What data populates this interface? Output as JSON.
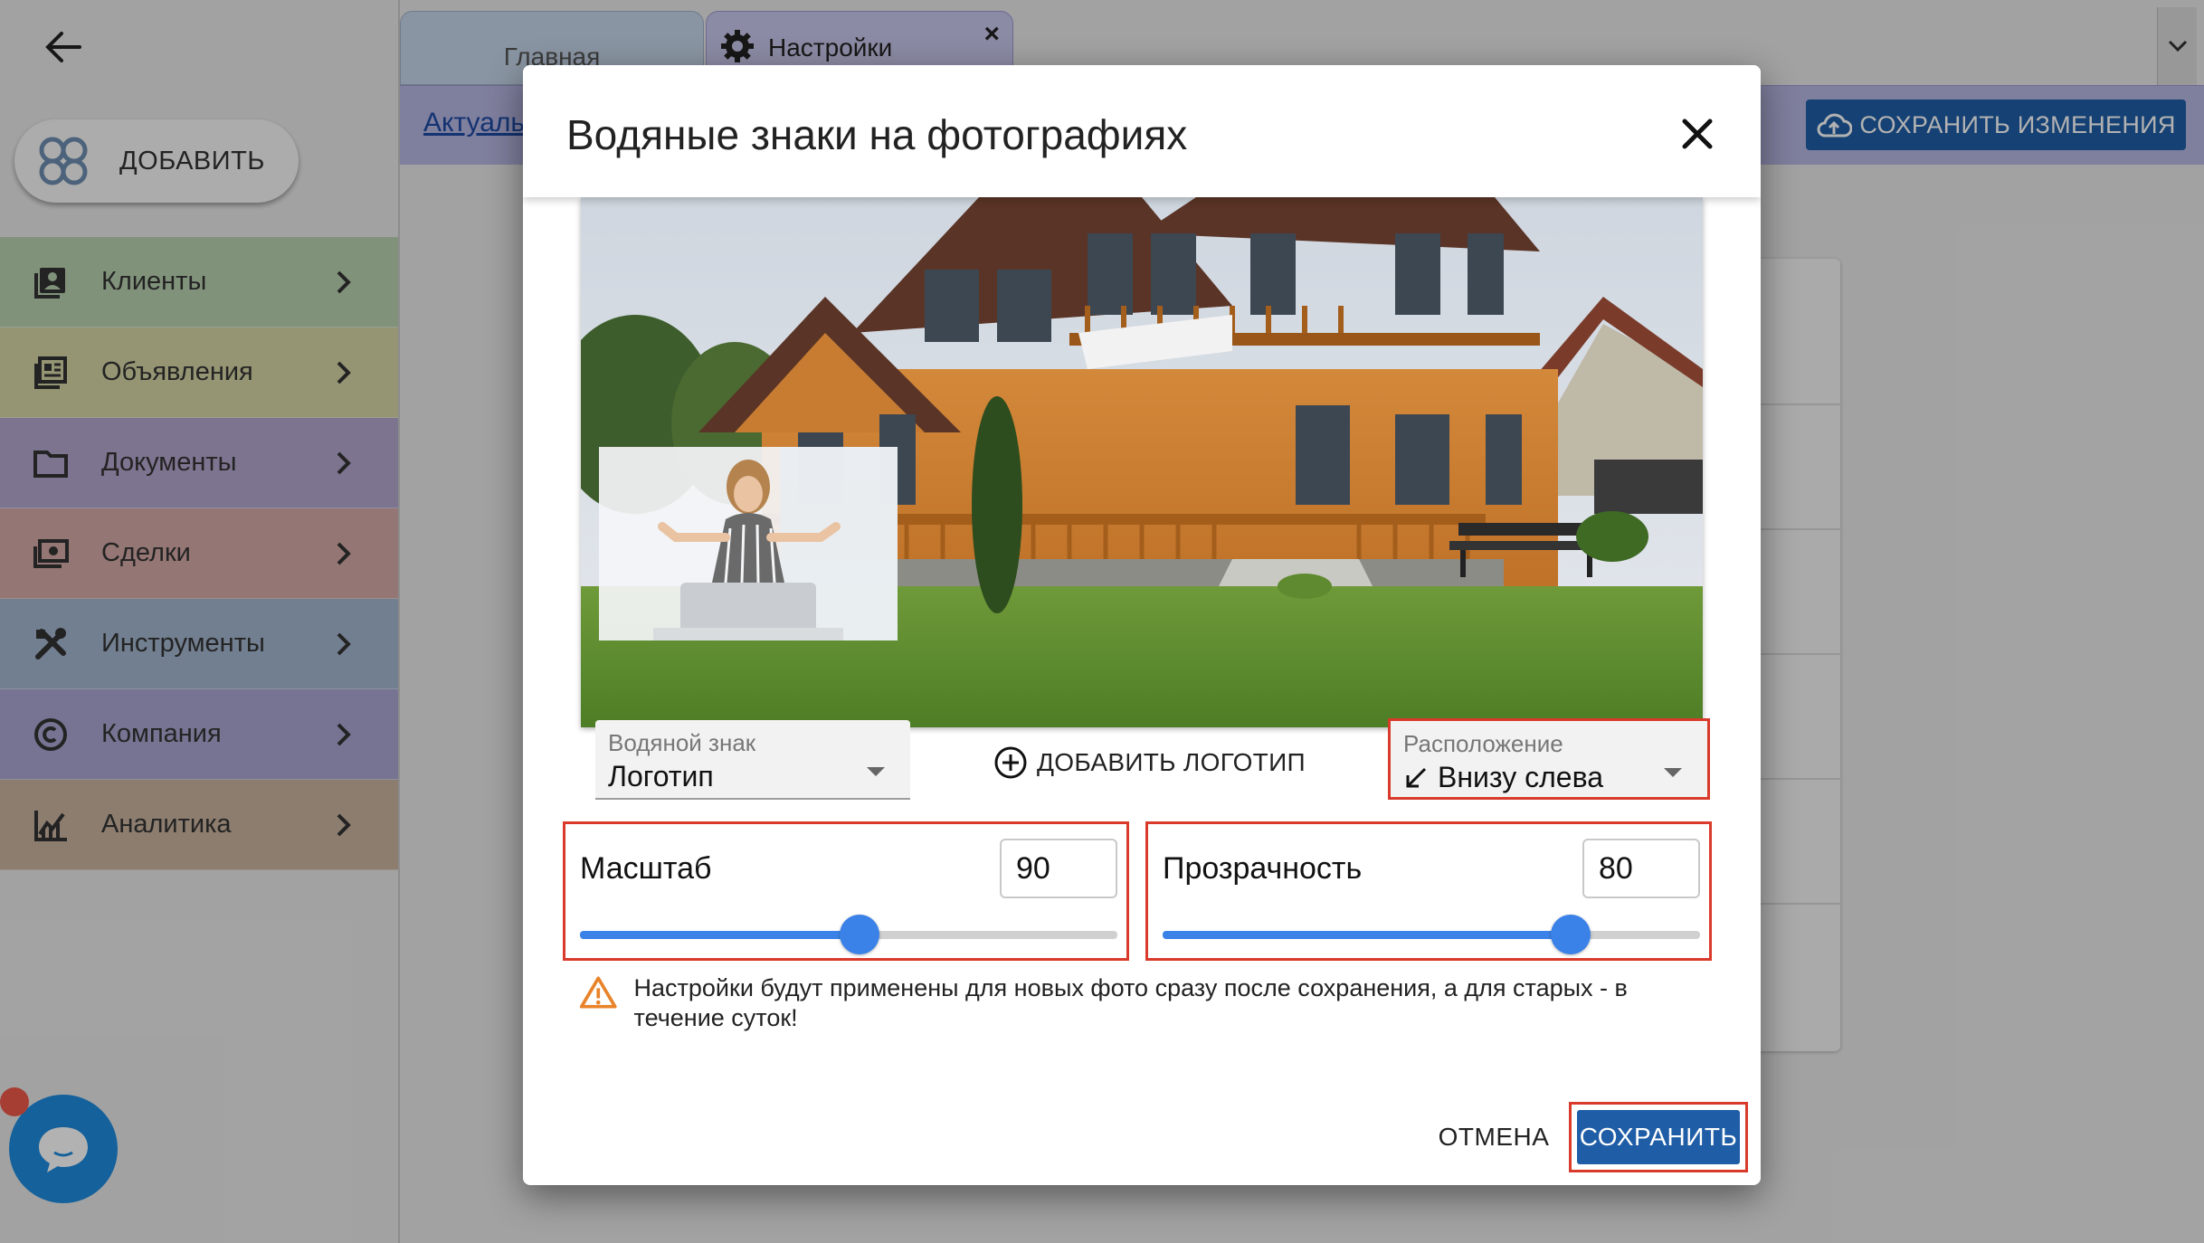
{
  "app": {
    "add_button_label": "ДОБАВИТЬ",
    "tabs": [
      {
        "label": "Главная"
      },
      {
        "label": "Настройки",
        "close": "×"
      }
    ],
    "subbar_link": "Актуаль",
    "save_changes_label": "СОХРАНИТЬ ИЗМЕНЕНИЯ",
    "sidebar": {
      "items": [
        {
          "label": "Клиенты",
          "icon": "contacts-icon",
          "color": "#b9d2b0"
        },
        {
          "label": "Объявления",
          "icon": "listings-icon",
          "color": "#d6d6a6"
        },
        {
          "label": "Документы",
          "icon": "folder-icon",
          "color": "#b4a6cf"
        },
        {
          "label": "Сделки",
          "icon": "money-icon",
          "color": "#d4a9a6"
        },
        {
          "label": "Инструменты",
          "icon": "tools-icon",
          "color": "#a4b6cf"
        },
        {
          "label": "Компания",
          "icon": "copyright-icon",
          "color": "#a9a7d1"
        },
        {
          "label": "Аналитика",
          "icon": "analytics-icon",
          "color": "#c9b3a0"
        }
      ]
    }
  },
  "dialog": {
    "title": "Водяные знаки на фотографиях",
    "watermark_select": {
      "label": "Водяной знак",
      "value": "Логотип"
    },
    "add_logo_label": "ДОБАВИТЬ ЛОГОТИП",
    "position_select": {
      "label": "Расположение",
      "value": "Внизу слева",
      "icon": "arrow-down-left-icon"
    },
    "scale": {
      "label": "Масштаб",
      "value": "90",
      "level": 0.52
    },
    "opacity": {
      "label": "Прозрачность",
      "value": "80",
      "level": 0.76
    },
    "notice": "Настройки будут применены для новых фото сразу после сохранения, а для старых - в течение суток!",
    "cancel_label": "ОТМЕНА",
    "save_label": "СОХРАНИТЬ"
  },
  "colors": {
    "primary": "#1f5da6",
    "slider": "#3b82e8",
    "highlight": "#d93a2b",
    "warning": "#e8832a"
  }
}
